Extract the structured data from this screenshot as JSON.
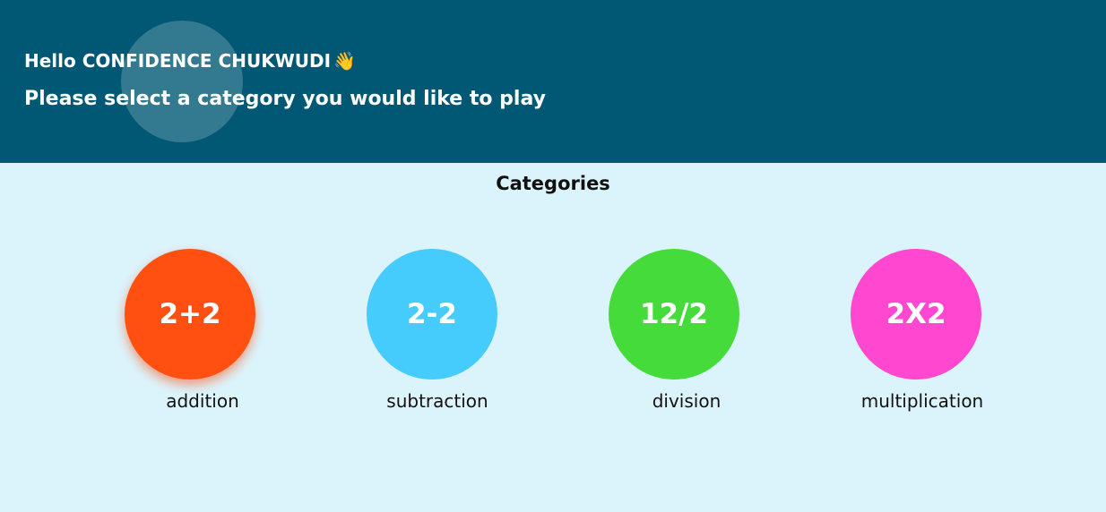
{
  "header": {
    "greeting": "Hello CONFIDENCE CHUKWUDI",
    "greeting_icon": "waving-hand-icon",
    "prompt": "Please select a category you would like to play",
    "background_color": "#005874"
  },
  "main": {
    "section_title": "Categories",
    "background_color": "#dbf4fc",
    "categories": [
      {
        "symbol": "2+2",
        "label": "addition",
        "color": "#ff5011"
      },
      {
        "symbol": "2-2",
        "label": "subtraction",
        "color": "#45cbfc"
      },
      {
        "symbol": "12/2",
        "label": "division",
        "color": "#45dc3b"
      },
      {
        "symbol": "2X2",
        "label": "multiplication",
        "color": "#ff47d0"
      }
    ]
  }
}
